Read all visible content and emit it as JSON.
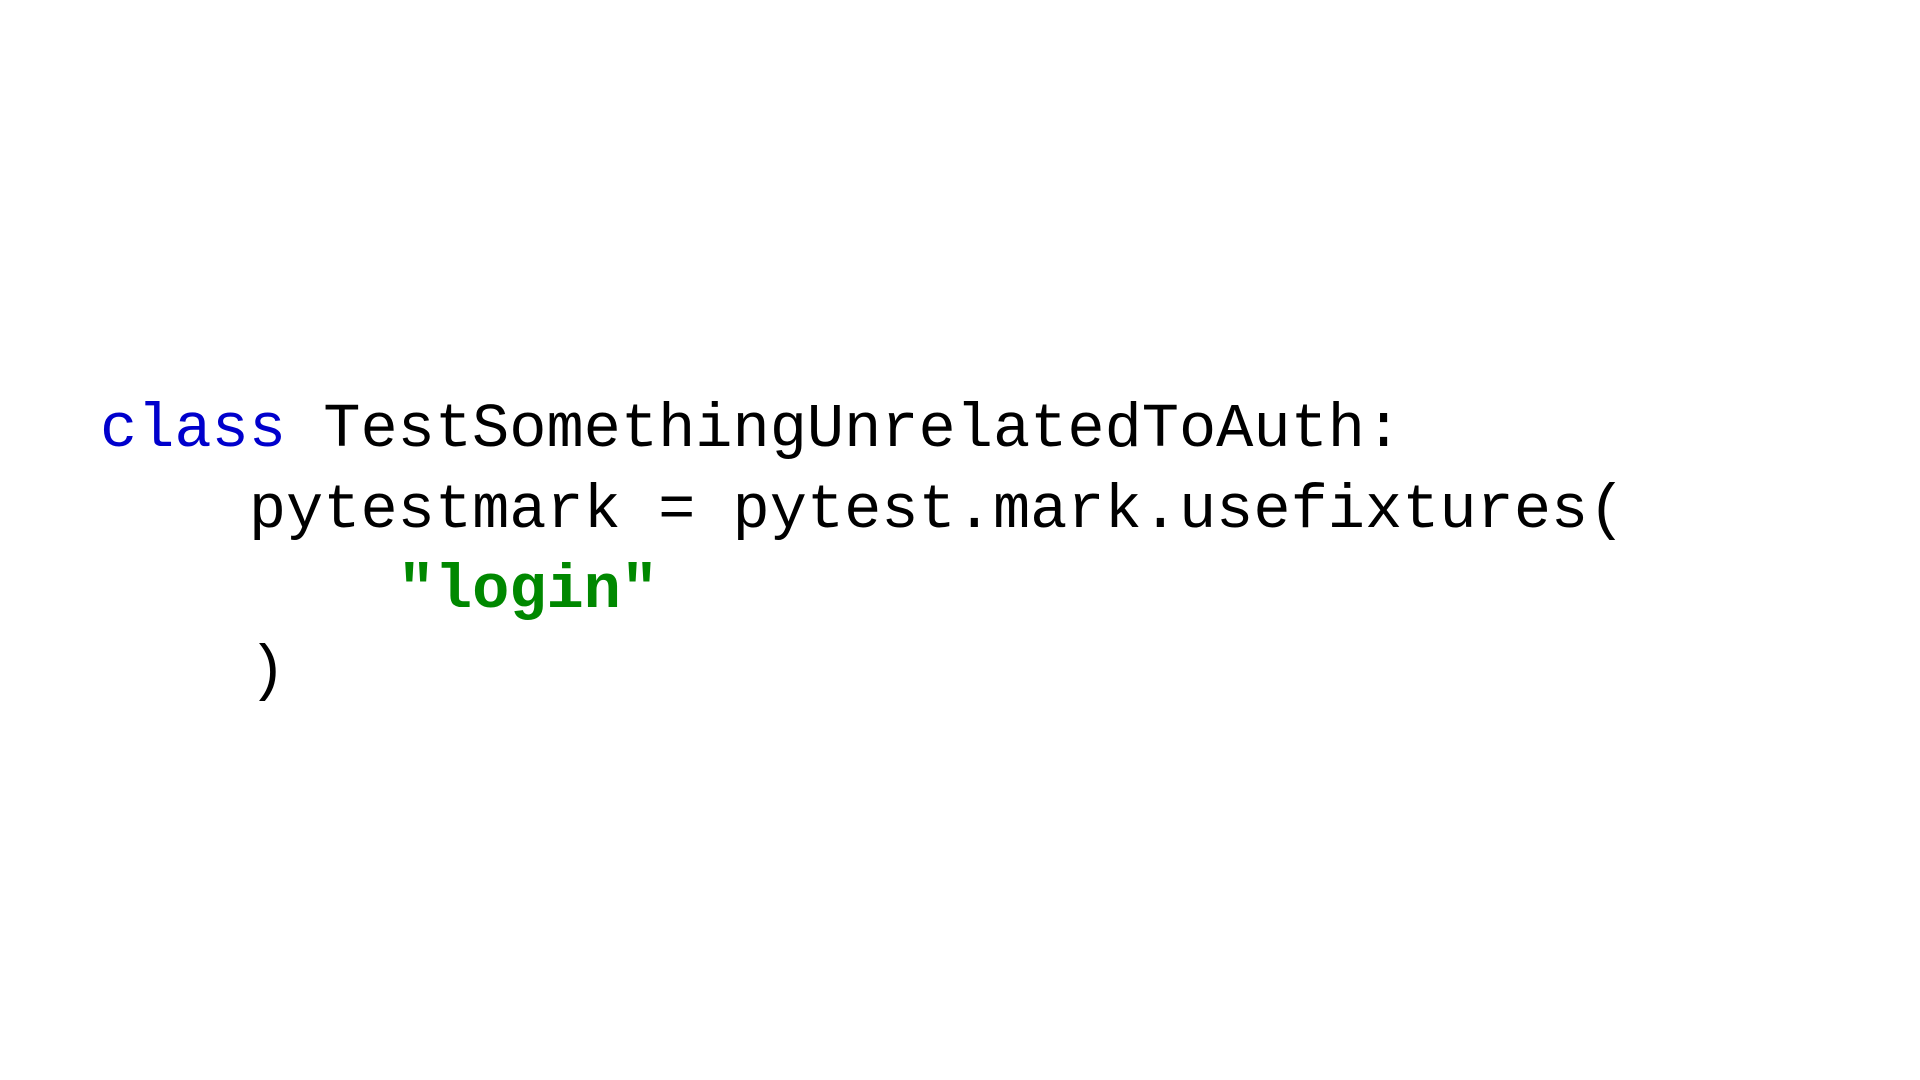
{
  "code": {
    "line1": {
      "keyword": "class",
      "rest": " TestSomethingUnrelatedToAuth:"
    },
    "line2": {
      "indent": "    ",
      "text": "pytestmark = pytest.mark.usefixtures("
    },
    "line3": {
      "indent": "        ",
      "string": "\"login\""
    },
    "line4": {
      "indent": "    ",
      "text": ")"
    }
  }
}
